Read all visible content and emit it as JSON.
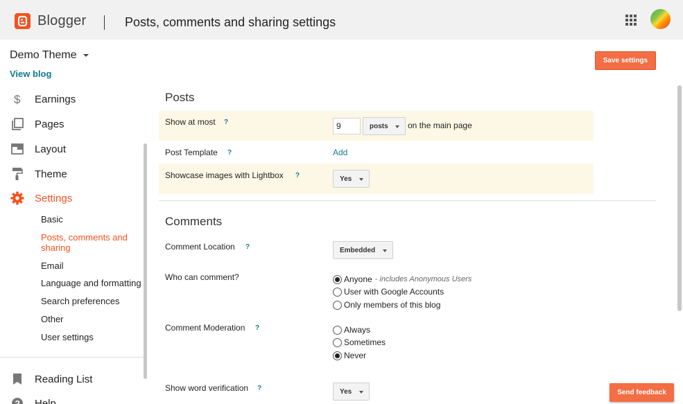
{
  "header": {
    "app_name": "Blogger",
    "page_title": "Posts, comments and sharing settings"
  },
  "sidebar": {
    "blog_name": "Demo Theme",
    "view_blog": "View blog",
    "nav": [
      {
        "label": "Earnings",
        "icon": "dollar-icon"
      },
      {
        "label": "Pages",
        "icon": "pages-icon"
      },
      {
        "label": "Layout",
        "icon": "layout-icon"
      },
      {
        "label": "Theme",
        "icon": "paint-roller-icon"
      },
      {
        "label": "Settings",
        "icon": "gear-icon",
        "active": true
      }
    ],
    "settings_sub": [
      {
        "label": "Basic"
      },
      {
        "label": "Posts, comments and sharing",
        "active": true
      },
      {
        "label": "Email"
      },
      {
        "label": "Language and formatting"
      },
      {
        "label": "Search preferences"
      },
      {
        "label": "Other"
      },
      {
        "label": "User settings"
      }
    ],
    "bottom_nav": [
      {
        "label": "Reading List",
        "icon": "bookmark-icon"
      },
      {
        "label": "Help",
        "icon": "help-icon"
      }
    ]
  },
  "actions": {
    "save": "Save settings",
    "feedback": "Send feedback"
  },
  "posts": {
    "title": "Posts",
    "show_at_most": {
      "label": "Show at most",
      "value": "9",
      "unit": "posts",
      "suffix": "on the main page"
    },
    "post_template": {
      "label": "Post Template",
      "link": "Add"
    },
    "lightbox": {
      "label": "Showcase images with Lightbox",
      "value": "Yes"
    }
  },
  "comments": {
    "title": "Comments",
    "location": {
      "label": "Comment Location",
      "value": "Embedded"
    },
    "who": {
      "label": "Who can comment?",
      "options": [
        {
          "label": "Anyone",
          "note": "- includes Anonymous Users",
          "checked": true
        },
        {
          "label": "User with Google Accounts",
          "checked": false
        },
        {
          "label": "Only members of this blog",
          "checked": false
        }
      ]
    },
    "moderation": {
      "label": "Comment Moderation",
      "options": [
        {
          "label": "Always",
          "checked": false
        },
        {
          "label": "Sometimes",
          "checked": false
        },
        {
          "label": "Never",
          "checked": true
        }
      ]
    },
    "word_verification": {
      "label": "Show word verification",
      "value": "Yes"
    }
  },
  "help_mark": "?",
  "colors": {
    "accent": "#f4511e",
    "button": "#f36d45",
    "link": "#0f7b8c",
    "highlight_row": "#fdf8e6"
  }
}
